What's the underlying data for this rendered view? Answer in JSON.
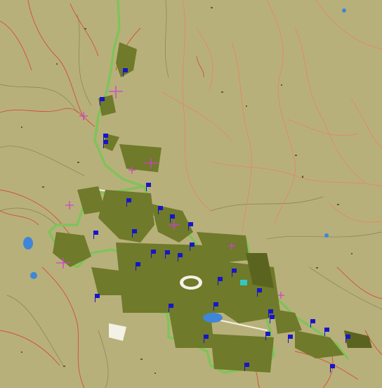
{
  "map": {
    "colors": {
      "background": "#b8b07a",
      "building": "#6f7a2a",
      "building_dark": "#5b641f",
      "main_road": "#7fc35a",
      "street": "#f4f1e6",
      "minor_road": "#d14f3a",
      "track": "#e08a64",
      "contour": "#7a7350",
      "water": "#3f86d8",
      "poi_flag": "#1616c8",
      "poi_pink": "#d23fd0",
      "square": "#34c7c2"
    },
    "icons": [
      "flag-icon",
      "pink-cross-icon",
      "water-pond-icon"
    ],
    "text_labels": []
  }
}
